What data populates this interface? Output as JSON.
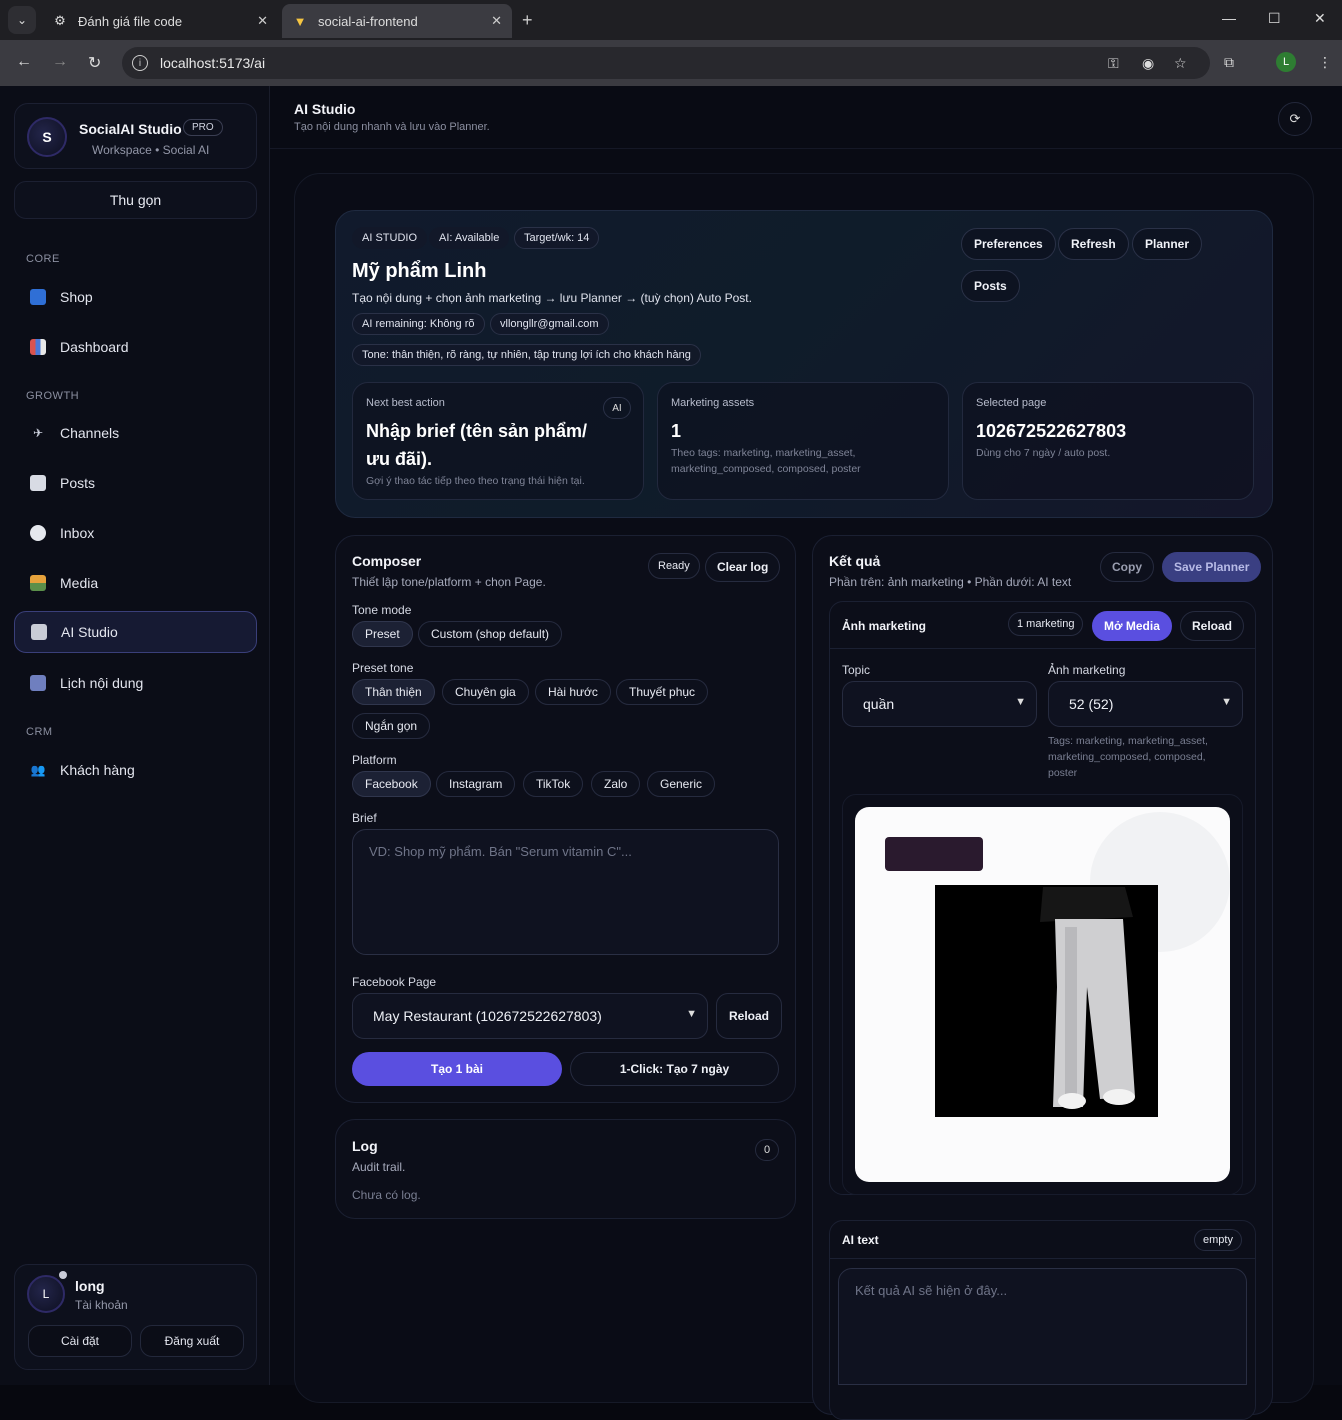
{
  "browser": {
    "tabs": [
      {
        "title": "Đánh giá file code",
        "active": false
      },
      {
        "title": "social-ai-frontend",
        "active": true
      }
    ],
    "url": "localhost:5173/ai",
    "profile_initial": "L"
  },
  "sidebar": {
    "brand_logo": "S",
    "brand_name": "SocialAI Studio",
    "brand_badge": "PRO",
    "brand_sub": "Workspace • Social AI",
    "collapse_label": "Thu gọn",
    "sections": {
      "core": "CORE",
      "growth": "GROWTH",
      "crm": "CRM"
    },
    "items": [
      {
        "label": "Shop",
        "icon": "shop-icon"
      },
      {
        "label": "Dashboard",
        "icon": "chart-icon"
      },
      {
        "label": "Channels",
        "icon": "satellite-icon"
      },
      {
        "label": "Posts",
        "icon": "newspaper-icon"
      },
      {
        "label": "Inbox",
        "icon": "chat-bubble-icon"
      },
      {
        "label": "Media",
        "icon": "picture-icon"
      },
      {
        "label": "AI Studio",
        "icon": "robot-icon",
        "active": true
      },
      {
        "label": "Lịch nội dung",
        "icon": "calendar-icon"
      },
      {
        "label": "Khách hàng",
        "icon": "people-icon"
      }
    ],
    "user": {
      "initial": "L",
      "name": "long",
      "sub": "Tài khoản",
      "settings": "Cài đặt",
      "logout": "Đăng xuất"
    }
  },
  "header": {
    "title": "AI Studio",
    "subtitle": "Tạo nội dung nhanh và lưu vào Planner."
  },
  "hero": {
    "pills": [
      "AI STUDIO",
      "AI: Available",
      "Target/wk: 14"
    ],
    "title": "Mỹ phẩm Linh",
    "description": "Tạo nội dung + chọn ảnh marketing → lưu Planner → (tuỳ chọn) Auto Post.",
    "meta_pills": [
      "AI remaining: Không rõ",
      "vllongllr@gmail.com"
    ],
    "tone_pill": "Tone: thân thiện, rõ ràng, tự nhiên, tập trung lợi ích cho khách hàng",
    "buttons": [
      "Preferences",
      "Refresh",
      "Planner",
      "Posts"
    ],
    "cards": {
      "next": {
        "label": "Next best action",
        "chip": "AI",
        "line1": "Nhập brief (tên sản phẩm/",
        "line2": "ưu đãi).",
        "note": "Gợi ý thao tác tiếp theo theo trạng thái hiện tại."
      },
      "assets": {
        "label": "Marketing assets",
        "value": "1",
        "note1": "Theo tags: marketing, marketing_asset,",
        "note2": "marketing_composed, composed, poster"
      },
      "page": {
        "label": "Selected page",
        "value": "102672522627803",
        "note": "Dùng cho 7 ngày / auto post."
      }
    }
  },
  "composer": {
    "title": "Composer",
    "subtitle": "Thiết lập tone/platform + chọn Page.",
    "ready": "Ready",
    "clear_log": "Clear log",
    "tone_mode_label": "Tone mode",
    "tone_modes": [
      "Preset",
      "Custom (shop default)"
    ],
    "preset_tone_label": "Preset tone",
    "preset_tones": [
      "Thân thiện",
      "Chuyên gia",
      "Hài hước",
      "Thuyết phục",
      "Ngắn gọn"
    ],
    "platform_label": "Platform",
    "platforms": [
      "Facebook",
      "Instagram",
      "TikTok",
      "Zalo",
      "Generic"
    ],
    "brief_label": "Brief",
    "brief_placeholder": "VD: Shop mỹ phẩm. Bán \"Serum vitamin C\"...",
    "fb_page_label": "Facebook Page",
    "fb_page_value": "May Restaurant (102672522627803)",
    "reload": "Reload",
    "create_one": "Tạo 1 bài",
    "one_click": "1-Click: Tạo 7 ngày"
  },
  "log": {
    "title": "Log",
    "subtitle": "Audit trail.",
    "count": "0",
    "empty": "Chưa có log."
  },
  "result": {
    "title": "Kết quả",
    "subtitle": "Phần trên: ảnh marketing • Phần dưới: AI text",
    "copy": "Copy",
    "save_planner": "Save Planner",
    "marketing": {
      "title": "Ảnh marketing",
      "count_pill": "1 marketing",
      "open_media": "Mở Media",
      "reload": "Reload",
      "topic_label": "Topic",
      "topic_value": "quần",
      "image_label": "Ảnh marketing",
      "image_value": "52 (52)",
      "tags_line1": "Tags: marketing, marketing_asset,",
      "tags_line2": "marketing_composed, composed,",
      "tags_line3": "poster"
    },
    "ai_text": {
      "title": "AI text",
      "badge": "empty",
      "placeholder": "Kết quả AI sẽ hiện ở đây..."
    }
  },
  "colors": {
    "accent": "#5a4fe0",
    "background": "#090b14",
    "panel": "#0c0e19"
  }
}
